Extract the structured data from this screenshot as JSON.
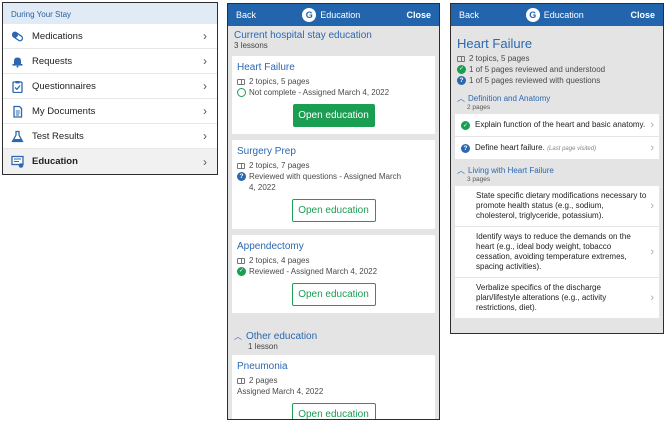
{
  "menu": {
    "section_title": "During Your Stay",
    "items": [
      {
        "label": "Medications",
        "icon": "pill-icon"
      },
      {
        "label": "Requests",
        "icon": "bell-icon"
      },
      {
        "label": "Questionnaires",
        "icon": "clipboard-icon"
      },
      {
        "label": "My Documents",
        "icon": "document-icon"
      },
      {
        "label": "Test Results",
        "icon": "flask-icon"
      },
      {
        "label": "Education",
        "icon": "education-icon"
      }
    ]
  },
  "nav": {
    "back": "Back",
    "logo_letter": "G",
    "title": "Education",
    "close": "Close"
  },
  "education": {
    "current_title": "Current hospital stay education",
    "current_count": "3 lessons",
    "cards": [
      {
        "title": "Heart Failure",
        "topics": "2 topics, 5 pages",
        "status": "Not complete - Assigned March 4, 2022",
        "button": "Open education"
      },
      {
        "title": "Surgery Prep",
        "topics": "2 topics, 7 pages",
        "status": "Reviewed with questions - Assigned March 4, 2022",
        "button": "Open education"
      },
      {
        "title": "Appendectomy",
        "topics": "2 topics, 4 pages",
        "status": "Reviewed - Assigned March 4, 2022",
        "button": "Open education"
      }
    ],
    "other_title": "Other education",
    "other_count": "1 lesson",
    "other_card": {
      "title": "Pneumonia",
      "topics": "2 pages",
      "assigned": "Assigned March 4, 2022",
      "button": "Open education"
    }
  },
  "lesson": {
    "title": "Heart Failure",
    "topics": "2 topics, 5 pages",
    "reviewed": "1 of 5 pages reviewed and understood",
    "questions": "1 of 5 pages reviewed with questions",
    "sections": [
      {
        "title": "Definition and Anatomy",
        "pages": "2 pages",
        "items": [
          {
            "text": "Explain function of the heart and basic anatomy.",
            "state": "check"
          },
          {
            "text": "Define heart failure.",
            "note": "(Last page visited)",
            "state": "question"
          }
        ]
      },
      {
        "title": "Living with Heart Failure",
        "pages": "3 pages",
        "items": [
          {
            "text": "State specific dietary modifications necessary to promote health status (e.g., sodium, cholesterol, triglyceride, potassium)."
          },
          {
            "text": "Identify ways to reduce the demands on the heart (e.g., ideal body weight, tobacco cessation, avoiding temperature extremes, spacing activities)."
          },
          {
            "text": "Verbalize specifics of the discharge plan/lifestyle alterations (e.g., activity restrictions, diet)."
          }
        ]
      }
    ]
  },
  "colors": {
    "nav_blue": "#2265ad",
    "link_blue": "#2c68b1",
    "green": "#1a9e52"
  }
}
